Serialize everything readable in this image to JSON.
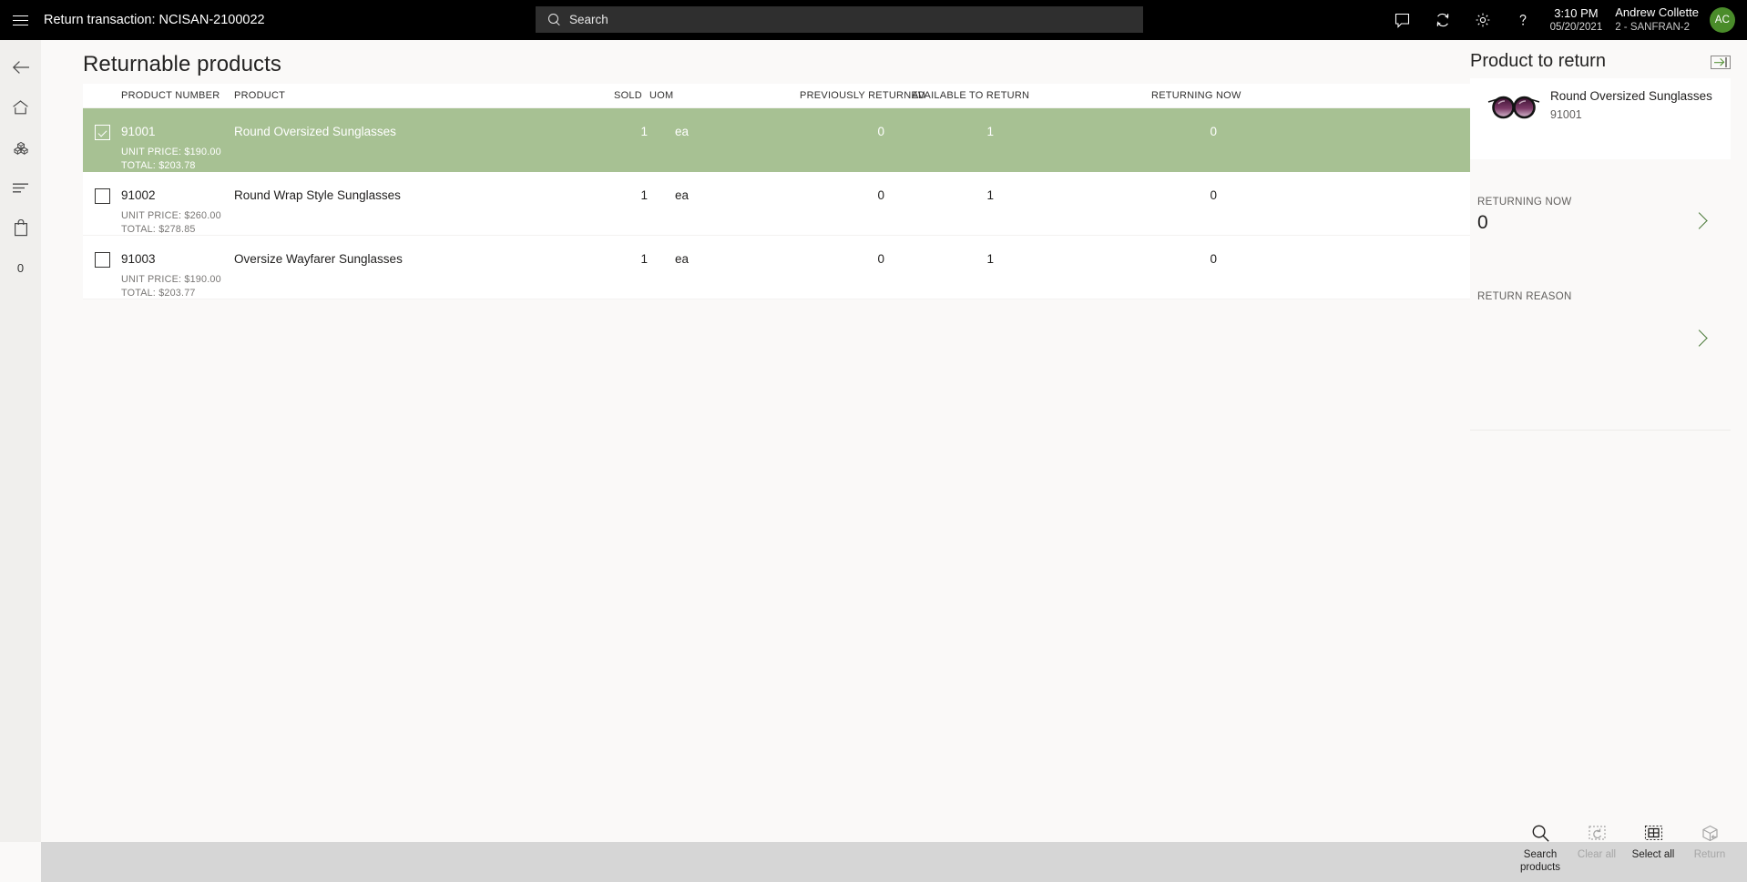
{
  "topbar": {
    "menu_icon": "hamburger-icon",
    "title": "Return transaction: NCISAN-2100022",
    "search": {
      "icon": "search-icon",
      "placeholder": "Search",
      "value": ""
    },
    "icons": [
      {
        "name": "message-icon"
      },
      {
        "name": "sync-icon"
      },
      {
        "name": "settings-gear-icon"
      },
      {
        "name": "help-question-icon"
      }
    ],
    "clock": {
      "time": "3:10 PM",
      "date": "05/20/2021"
    },
    "user": {
      "name": "Andrew Collette",
      "store": "2 - SANFRAN-2",
      "initials": "AC",
      "avatar_color": "#4a8c2a"
    }
  },
  "rail": {
    "items": [
      {
        "name": "back-arrow-icon",
        "label": ""
      },
      {
        "name": "home-icon",
        "label": ""
      },
      {
        "name": "products-cubes-icon",
        "label": ""
      },
      {
        "name": "journal-lines-icon",
        "label": ""
      },
      {
        "name": "bag-icon",
        "label": ""
      },
      {
        "name": "cart-count",
        "label": "0"
      }
    ]
  },
  "main": {
    "page_title": "Returnable products",
    "columns": [
      "PRODUCT NUMBER",
      "PRODUCT",
      "SOLD",
      "UOM",
      "PREVIOUSLY RETURNED",
      "AVAILABLE TO RETURN",
      "RETURNING NOW"
    ],
    "rows": [
      {
        "selected": true,
        "product_number": "91001",
        "product": "Round Oversized Sunglasses",
        "sold": "1",
        "uom": "ea",
        "previously_returned": "0",
        "available_to_return": "1",
        "returning_now": "0",
        "unit_price": "UNIT PRICE: $190.00",
        "total": "TOTAL: $203.78"
      },
      {
        "selected": false,
        "product_number": "91002",
        "product": "Round Wrap Style Sunglasses",
        "sold": "1",
        "uom": "ea",
        "previously_returned": "0",
        "available_to_return": "1",
        "returning_now": "0",
        "unit_price": "UNIT PRICE: $260.00",
        "total": "TOTAL: $278.85"
      },
      {
        "selected": false,
        "product_number": "91003",
        "product": "Oversize Wayfarer Sunglasses",
        "sold": "1",
        "uom": "ea",
        "previously_returned": "0",
        "available_to_return": "1",
        "returning_now": "0",
        "unit_price": "UNIT PRICE: $190.00",
        "total": "TOTAL: $203.77"
      }
    ]
  },
  "right_panel": {
    "title": "Product to return",
    "expand_icon": "expand-panel-icon",
    "product": {
      "image": "sunglasses-thumbnail",
      "name": "Round Oversized Sunglasses",
      "number": "91001"
    },
    "fields": [
      {
        "label": "RETURNING NOW",
        "value": "0",
        "chevron": "chevron-right-icon"
      },
      {
        "label": "RETURN REASON",
        "value": "",
        "chevron": "chevron-right-icon"
      }
    ]
  },
  "bottom_bar": {
    "buttons": [
      {
        "label": "Search products",
        "icon": "magnifier-icon",
        "disabled": false
      },
      {
        "label": "Clear all",
        "icon": "clear-all-icon",
        "disabled": true
      },
      {
        "label": "Select all",
        "icon": "select-all-grid-icon",
        "disabled": false
      },
      {
        "label": "Return",
        "icon": "return-box-icon",
        "disabled": true
      }
    ]
  },
  "colors": {
    "selected_row": "#a7c193",
    "topbar": "#000000",
    "rail": "#f0efed",
    "canvas": "#faf9f8",
    "bottom_bar": "#d6d6d6",
    "accent_green": "#4a8c2a"
  }
}
